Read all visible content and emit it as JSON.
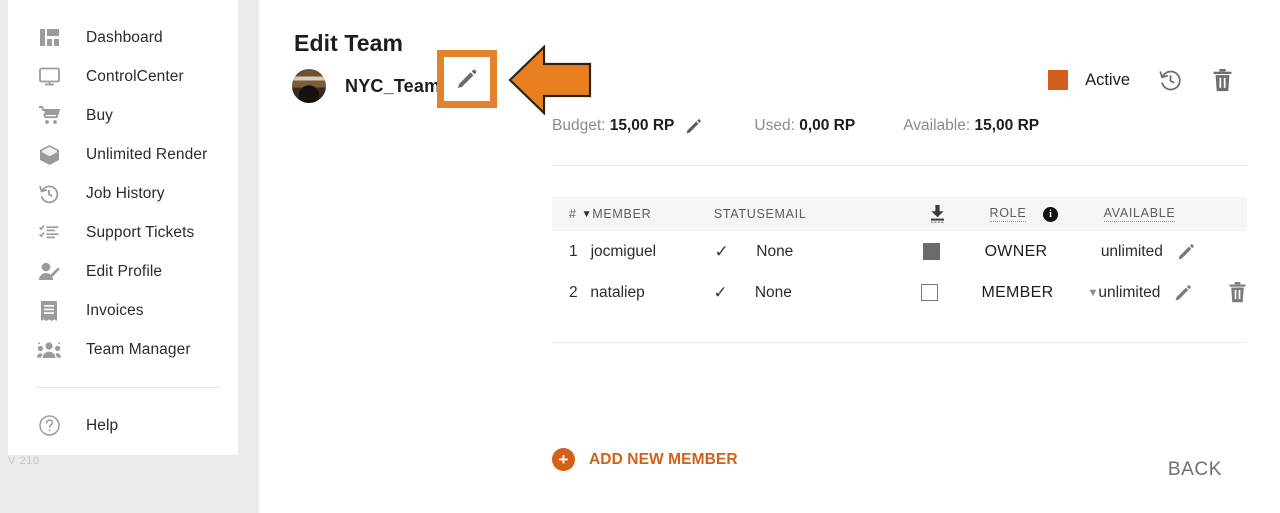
{
  "app": {
    "version_label": "V 210",
    "accent_orange": "#d2601a",
    "highlight_orange": "#e3822b"
  },
  "sidebar": {
    "items": [
      {
        "label": "Dashboard",
        "icon": "dashboard-icon"
      },
      {
        "label": "ControlCenter",
        "icon": "monitor-icon"
      },
      {
        "label": "Buy",
        "icon": "cart-icon"
      },
      {
        "label": "Unlimited Render",
        "icon": "box-icon"
      },
      {
        "label": "Job History",
        "icon": "history-icon"
      },
      {
        "label": "Support Tickets",
        "icon": "list-icon"
      },
      {
        "label": "Edit Profile",
        "icon": "user-edit-icon"
      },
      {
        "label": "Invoices",
        "icon": "invoice-icon"
      },
      {
        "label": "Team Manager",
        "icon": "team-icon"
      }
    ],
    "help": {
      "label": "Help",
      "icon": "help-icon"
    }
  },
  "header": {
    "title": "Edit Team",
    "team_name": "NYC_Team",
    "avatar": "team-avatar",
    "edit_name_icon": "pencil-icon",
    "budget_label": "Budget:",
    "budget_value": "15,00 RP",
    "budget_edit_icon": "pencil-icon",
    "used_label": "Used:",
    "used_value": "0,00 RP",
    "available_label": "Available:",
    "available_value": "15,00 RP",
    "status_label": "Active",
    "status_color": "#d2601a",
    "history_icon": "history-icon",
    "delete_icon": "trash-icon"
  },
  "table": {
    "columns": {
      "num": "#",
      "member": "MEMBER",
      "status": "STATUS",
      "email": "EMAIL",
      "download_icon": "download-icon",
      "role": "ROLE",
      "role_info_icon": "info-icon",
      "available": "AVAILABLE"
    },
    "rows": [
      {
        "num": "1",
        "member": "jocmiguel",
        "status": "✓",
        "email": "None",
        "checkbox": "checked",
        "role": "OWNER",
        "role_dropdown": false,
        "available": "unlimited",
        "edit_icon": "pencil-icon",
        "delete_icon": null
      },
      {
        "num": "2",
        "member": "nataliep",
        "status": "✓",
        "email": "None",
        "checkbox": "unchecked",
        "role": "MEMBER",
        "role_dropdown": true,
        "available": "unlimited",
        "edit_icon": "pencil-icon",
        "delete_icon": "trash-icon"
      }
    ]
  },
  "footer": {
    "add_member_label": "ADD NEW MEMBER",
    "add_member_icon": "plus-circle-icon",
    "back_label": "BACK"
  },
  "annotation": {
    "highlight_box_icon": "pencil-icon",
    "arrow_icon": "left-arrow-annotation"
  }
}
